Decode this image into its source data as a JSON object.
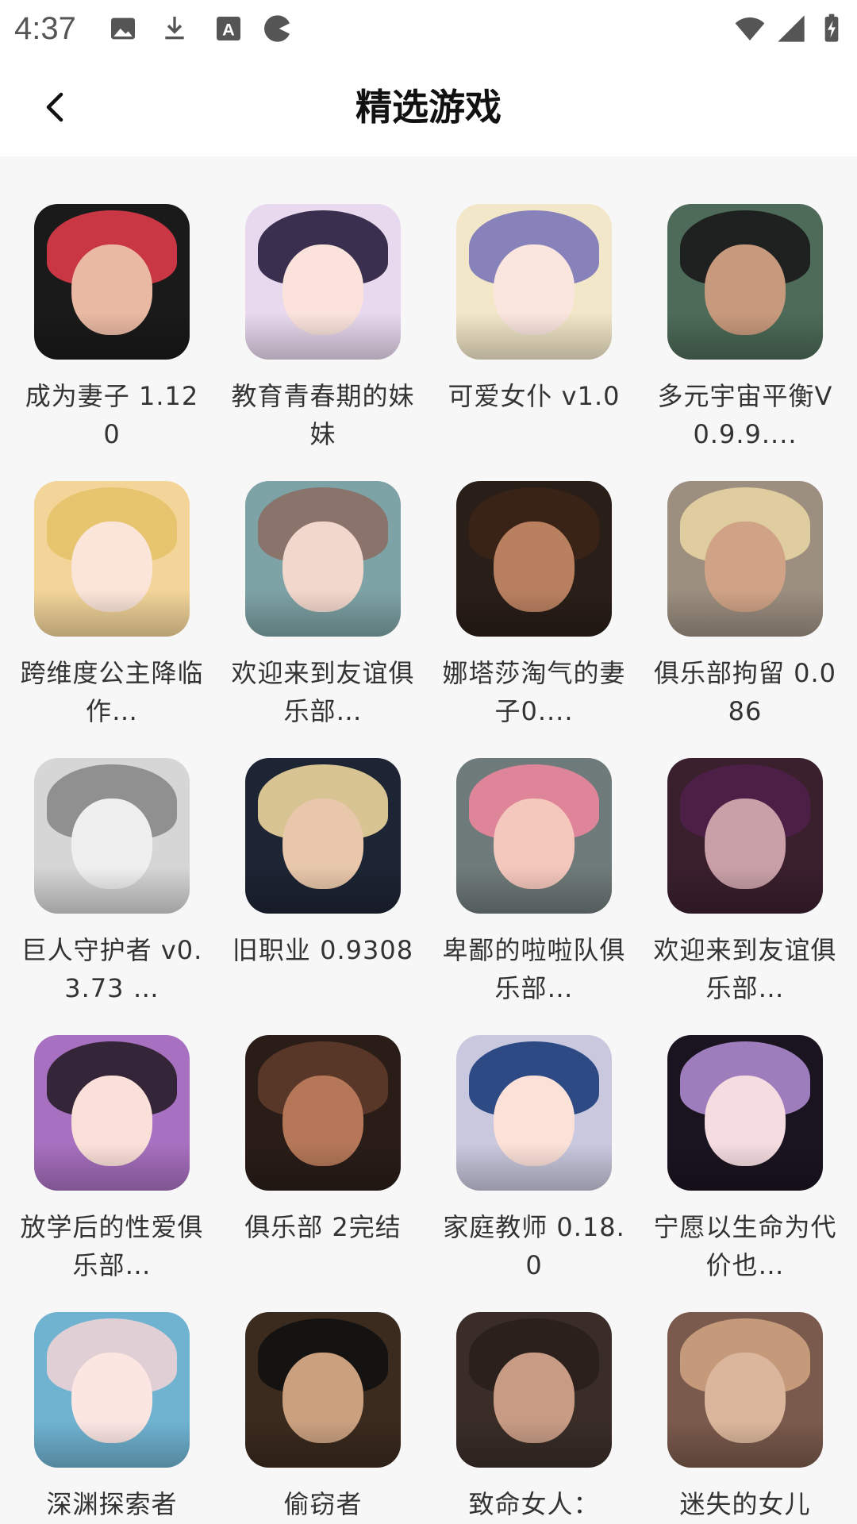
{
  "status_bar": {
    "time": "4:37",
    "left_icons": [
      "image-icon",
      "download-icon",
      "text-a-icon",
      "pacman-icon"
    ],
    "right_icons": [
      "wifi-icon",
      "signal-icon",
      "battery-icon"
    ]
  },
  "header": {
    "title": "精选游戏",
    "back_icon": "chevron-left-icon"
  },
  "games": [
    {
      "label": "成为妻子 1.120",
      "bg": "#1a1a1a",
      "hair": "#d93a48",
      "face": "#e9b9a3"
    },
    {
      "label": "教育青春期的妹妹",
      "bg": "#e9d9ee",
      "hair": "#2a2140",
      "face": "#fbe3dc"
    },
    {
      "label": "可爱女仆 v1.0",
      "bg": "#f2e7c8",
      "hair": "#7f7ab8",
      "face": "#fbe6df"
    },
    {
      "label": "多元宇宙平衡V0.9.9....",
      "bg": "#4d6b58",
      "hair": "#1b1b1b",
      "face": "#c89a7d"
    },
    {
      "label": "跨维度公主降临 作…",
      "bg": "#f3d59a",
      "hair": "#e6c26a",
      "face": "#fbe4d8"
    },
    {
      "label": "欢迎来到友谊俱乐部…",
      "bg": "#7ea3a6",
      "hair": "#8a6f66",
      "face": "#f2d8cc"
    },
    {
      "label": "娜塔莎淘气的妻子0....",
      "bg": "#2a1e18",
      "hair": "#3b2418",
      "face": "#b98060"
    },
    {
      "label": "俱乐部拘留 0.086",
      "bg": "#9c8f80",
      "hair": "#e6d2a2",
      "face": "#d0a386"
    },
    {
      "label": "巨人守护者 v0.3.73 …",
      "bg": "#d6d6d6",
      "hair": "#8a8a8a",
      "face": "#efefef"
    },
    {
      "label": "旧职业 0.9308",
      "bg": "#1d2433",
      "hair": "#e8d29a",
      "face": "#e8c7aa"
    },
    {
      "label": "卑鄙的啦啦队俱乐部…",
      "bg": "#6f7b7a",
      "hair": "#e8869c",
      "face": "#f5c8bd"
    },
    {
      "label": "欢迎来到友谊俱乐部…",
      "bg": "#3a1f2d",
      "hair": "#4e2149",
      "face": "#caa0a8"
    },
    {
      "label": "放学后的性爱俱乐部…",
      "bg": "#a870c0",
      "hair": "#2a1e2c",
      "face": "#fae0d8"
    },
    {
      "label": "俱乐部 2完结",
      "bg": "#2a1d18",
      "hair": "#5c3a2a",
      "face": "#b57758"
    },
    {
      "label": "家庭教师 0.18.0",
      "bg": "#c9c8de",
      "hair": "#1f3f7c",
      "face": "#fbe1d8"
    },
    {
      "label": "宁愿以生命为代价也…",
      "bg": "#1a1420",
      "hair": "#a887c9",
      "face": "#f4dce0"
    },
    {
      "label": "深渊探索者",
      "bg": "#6fb3d1",
      "hair": "#ead1d6",
      "face": "#fbe6e2"
    },
    {
      "label": "偷窃者",
      "bg": "#3b2a1e",
      "hair": "#111111",
      "face": "#caa07f"
    },
    {
      "label": "致命女人：",
      "bg": "#3a2d28",
      "hair": "#2a1f1a",
      "face": "#c79b84"
    },
    {
      "label": "迷失的女儿",
      "bg": "#7a5a4c",
      "hair": "#caa07f",
      "face": "#dbb69c"
    }
  ]
}
